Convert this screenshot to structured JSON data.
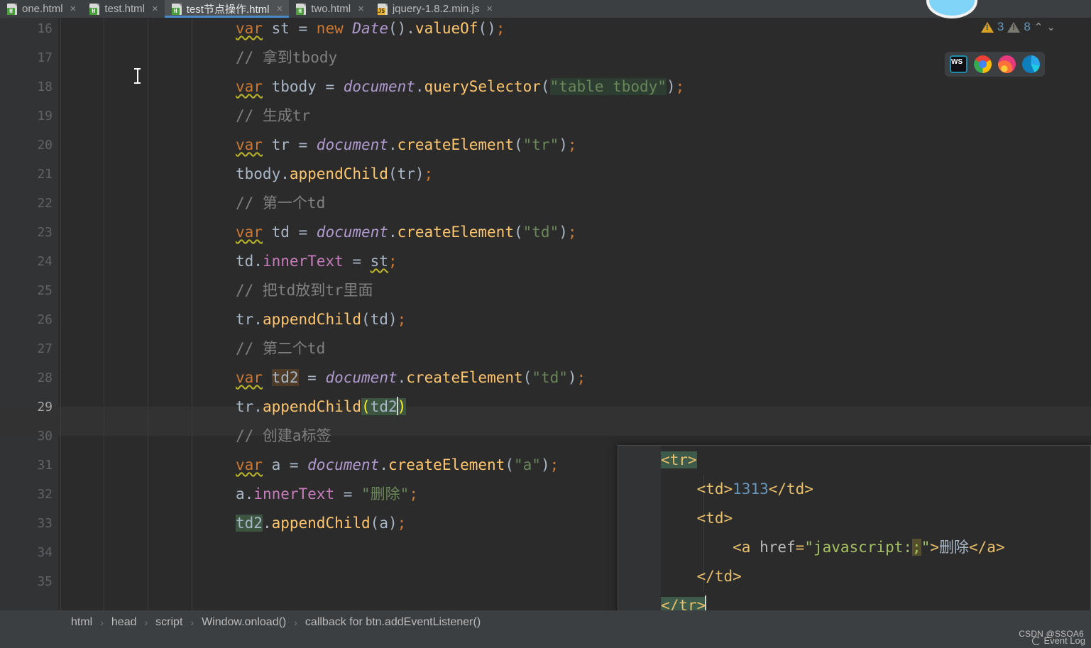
{
  "tabs": [
    {
      "label": "one.html",
      "icon": "html-file-icon",
      "badge": "H",
      "selected": false
    },
    {
      "label": "test.html",
      "icon": "html-file-icon",
      "badge": "H",
      "selected": false
    },
    {
      "label": "test节点操作.html",
      "icon": "html-file-icon",
      "badge": "H",
      "selected": true
    },
    {
      "label": "two.html",
      "icon": "html-file-icon",
      "badge": "H",
      "selected": false
    },
    {
      "label": "jquery-1.8.2.min.js",
      "icon": "js-file-icon",
      "badge": "JS",
      "selected": false
    }
  ],
  "tab_close_glyph": "×",
  "editor": {
    "first_line_number": 16,
    "current_line_number": 29,
    "line_numbers": [
      "16",
      "17",
      "18",
      "19",
      "20",
      "21",
      "22",
      "23",
      "24",
      "25",
      "26",
      "27",
      "28",
      "29",
      "30",
      "31",
      "32",
      "33",
      "34",
      "35"
    ],
    "lines": [
      "var st = new Date().valueOf();",
      "// 拿到tbody",
      "var tbody = document.querySelector(\"table tbody\");",
      "// 生成tr",
      "var tr = document.createElement(\"tr\");",
      "tbody.appendChild(tr);",
      "// 第一个td",
      "var td = document.createElement(\"td\");",
      "td.innerText = st;",
      "// 把td放到tr里面",
      "tr.appendChild(td);",
      "// 第二个td",
      "var td2 = document.createElement(\"td\");",
      "tr.appendChild(td2)",
      "// 创建a标签",
      "var a = document.createElement(\"a\");",
      "a.innerText = \"删除\";",
      "td2.appendChild(a);",
      "",
      ""
    ]
  },
  "inspections": {
    "warning_count": "3",
    "weak_warning_count": "8",
    "up_chevron": "⌃",
    "down_chevron": "⌄"
  },
  "browser_bar": {
    "items": [
      {
        "name": "webstorm-icon",
        "label": "WS"
      },
      {
        "name": "chrome-icon",
        "label": "Chrome"
      },
      {
        "name": "firefox-icon",
        "label": "Firefox"
      },
      {
        "name": "edge-icon",
        "label": "Edge"
      }
    ]
  },
  "popup_editor": {
    "lines": [
      "<tr>",
      "    <td>1313</td>",
      "    <td>",
      "        <a href=\"javascript:;\">删除</a>",
      "    </td>",
      "</tr>"
    ],
    "number_value": "1313",
    "link_text": "删除",
    "href_value": "javascript:;"
  },
  "breadcrumbs": {
    "separator": "›",
    "items": [
      "html",
      "head",
      "script",
      "Window.onload()",
      "callback for btn.addEventListener()"
    ]
  },
  "statusbar": {
    "event_log": "Event Log"
  },
  "watermark": "CSDN @SSOA6",
  "colors": {
    "editor_bg": "#2b2b2b",
    "gutter_bg": "#313335",
    "chrome_bg": "#3c3f41",
    "current_line": "#323232",
    "tab_accent": "#4a88c7",
    "keyword": "#cc7832",
    "string": "#6a8759",
    "function": "#ffc66d",
    "comment": "#808080",
    "number": "#6897bb",
    "class": "#b09ad0",
    "property": "#c77dbb",
    "default_text": "#a9b7c6",
    "warning": "#d6a020"
  }
}
